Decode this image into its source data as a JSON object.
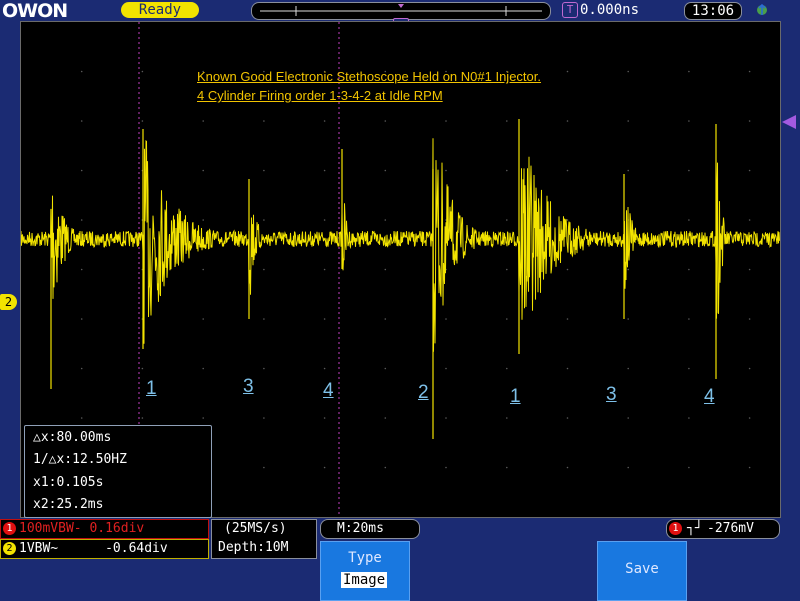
{
  "header": {
    "logo": "OWON",
    "status": "Ready",
    "trigger_time_badge": "T",
    "trigger_time": "0.000ns",
    "clock": "13:06",
    "usb_icon": "usb-icon"
  },
  "screen": {
    "trigger_pos_badge": "T",
    "channel_marker": "2",
    "annotation_line1": "Known Good Electronic  Stethoscope  Held on N0#1 Injector.",
    "annotation_line2": "4 Cylinder Firing order  1-3-4-2     at Idle RPM",
    "cylinder_labels": [
      "1",
      "3",
      "4",
      "2",
      "1",
      "3",
      "4"
    ],
    "colors": {
      "trace": "#f2e300",
      "cursor": "#c040c0",
      "grid": "#5a5a5a",
      "annotation": "#f2c400",
      "cylinder_label": "#7ec0e8"
    }
  },
  "measure": {
    "dx": "△x:80.00ms",
    "inv_dx": "1/△x:12.50HZ",
    "x1": "x1:0.105s",
    "x2": "x2:25.2ms"
  },
  "bottom": {
    "ch1_badge": "1",
    "ch1": "100mVBW- 0.16div",
    "ch2_badge": "2",
    "ch2": "1VBW~      -0.64div",
    "sample_rate": "(25MS/s)",
    "depth": "Depth:10M",
    "timebase": "M:20ms",
    "trig_badge": "1",
    "trig_slope": "┐┘",
    "trig_level": "-276mV"
  },
  "softkeys": {
    "type_label": "Type",
    "type_value": "Image",
    "save_label": "Save"
  }
}
